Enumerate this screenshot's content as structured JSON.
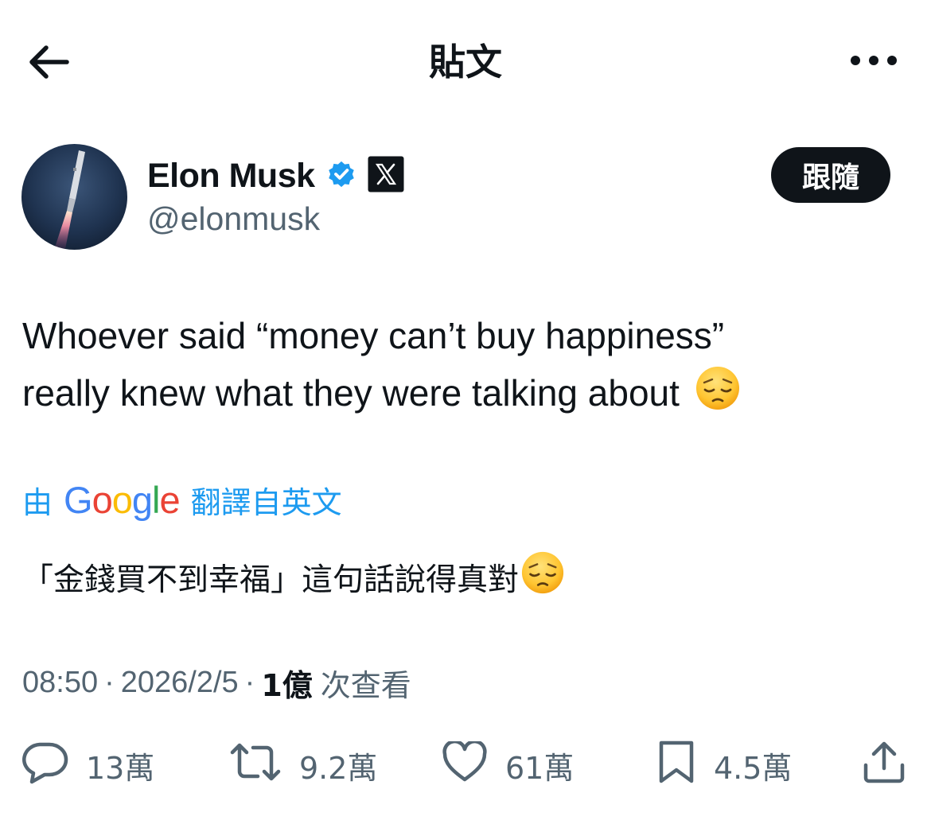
{
  "header": {
    "title": "貼文",
    "back_icon": "arrow-left-icon",
    "more_icon": "more-horizontal-icon"
  },
  "author": {
    "name": "Elon Musk",
    "handle": "@elonmusk",
    "verified_icon": "verified-badge-icon",
    "affiliate_icon": "x-logo-icon",
    "follow_label": "跟隨"
  },
  "tweet": {
    "text_line1": "Whoever said “money can’t buy happiness”",
    "text_line2": "really knew what they were talking about",
    "emoji_icon": "pensive-face-icon"
  },
  "translation": {
    "prefix": "由",
    "provider": "Google",
    "suffix": "翻譯自英文",
    "text": "「金錢買不到幸福」這句話說得真對"
  },
  "meta": {
    "time": "08:50",
    "separator": "·",
    "date": "2026/2/5",
    "views_count": "1億",
    "views_label": "次查看"
  },
  "actions": {
    "replies": "13萬",
    "reposts": "9.2萬",
    "likes": "61萬",
    "bookmarks": "4.5萬"
  },
  "colors": {
    "text": "#0f1419",
    "secondary": "#536471",
    "accent": "#1d9bf0",
    "google_blue": "#4285F4",
    "google_red": "#EA4335",
    "google_yellow": "#FBBC05",
    "google_green": "#34A853"
  }
}
